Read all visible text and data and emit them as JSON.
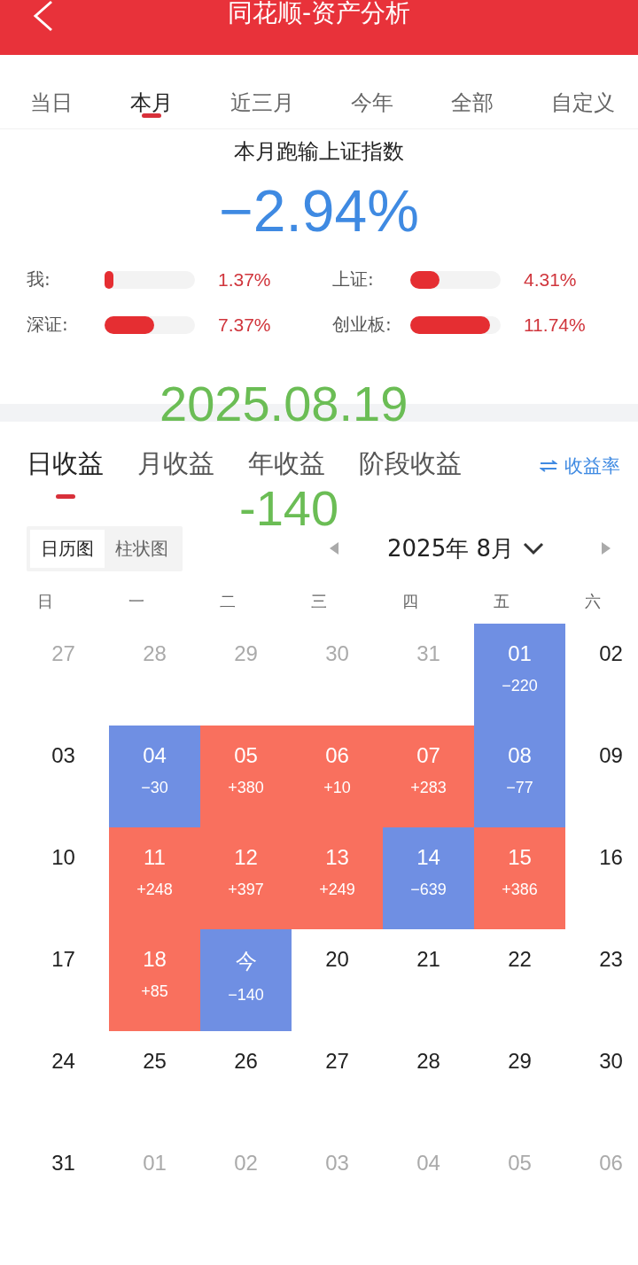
{
  "header": {
    "title": "同花顺-资产分析"
  },
  "period_tabs": [
    {
      "label": "当日",
      "selected": false
    },
    {
      "label": "本月",
      "selected": true
    },
    {
      "label": "近三月",
      "selected": false
    },
    {
      "label": "今年",
      "selected": false
    },
    {
      "label": "全部",
      "selected": false
    },
    {
      "label": "自定义",
      "selected": false
    }
  ],
  "summary": {
    "title": "本月跑输上证指数",
    "value": "−2.94%"
  },
  "comparisons": [
    {
      "label": "我:",
      "level": 0.1,
      "reading": "1.37%"
    },
    {
      "label": "上证:",
      "level": 0.32,
      "reading": "4.31%"
    },
    {
      "label": "深证:",
      "level": 0.55,
      "reading": "7.37%"
    },
    {
      "label": "创业板:",
      "level": 0.88,
      "reading": "11.74%"
    }
  ],
  "overlay": {
    "date": "2025.08.19",
    "amount": "-140"
  },
  "profit_tabs": [
    {
      "label": "日收益",
      "selected": true
    },
    {
      "label": "月收益",
      "selected": false
    },
    {
      "label": "年收益",
      "selected": false
    },
    {
      "label": "阶段收益",
      "selected": false
    }
  ],
  "rate_toggle": "收益率",
  "view_toggle": [
    {
      "label": "日历图",
      "selected": true
    },
    {
      "label": "柱状图",
      "selected": false
    }
  ],
  "month": "2025年 8月",
  "weekdays": [
    "日",
    "一",
    "二",
    "三",
    "四",
    "五",
    "六"
  ],
  "days": [
    {
      "day": "27",
      "kind": "other"
    },
    {
      "day": "28",
      "kind": "other"
    },
    {
      "day": "29",
      "kind": "other"
    },
    {
      "day": "30",
      "kind": "other"
    },
    {
      "day": "31",
      "kind": "other"
    },
    {
      "day": "01",
      "kind": "loss",
      "value": "−220"
    },
    {
      "day": "02",
      "kind": "plain"
    },
    {
      "day": "03",
      "kind": "plain"
    },
    {
      "day": "04",
      "kind": "loss",
      "value": "−30"
    },
    {
      "day": "05",
      "kind": "gain",
      "value": "+380"
    },
    {
      "day": "06",
      "kind": "gain",
      "value": "+10"
    },
    {
      "day": "07",
      "kind": "gain",
      "value": "+283"
    },
    {
      "day": "08",
      "kind": "loss",
      "value": "−77"
    },
    {
      "day": "09",
      "kind": "plain"
    },
    {
      "day": "10",
      "kind": "plain"
    },
    {
      "day": "11",
      "kind": "gain",
      "value": "+248"
    },
    {
      "day": "12",
      "kind": "gain",
      "value": "+397"
    },
    {
      "day": "13",
      "kind": "gain",
      "value": "+249"
    },
    {
      "day": "14",
      "kind": "loss",
      "value": "−639"
    },
    {
      "day": "15",
      "kind": "gain",
      "value": "+386"
    },
    {
      "day": "16",
      "kind": "plain"
    },
    {
      "day": "17",
      "kind": "plain"
    },
    {
      "day": "18",
      "kind": "gain",
      "value": "+85"
    },
    {
      "day": "今",
      "kind": "loss",
      "value": "−140"
    },
    {
      "day": "20",
      "kind": "plain"
    },
    {
      "day": "21",
      "kind": "plain"
    },
    {
      "day": "22",
      "kind": "plain"
    },
    {
      "day": "23",
      "kind": "plain"
    },
    {
      "day": "24",
      "kind": "plain"
    },
    {
      "day": "25",
      "kind": "plain"
    },
    {
      "day": "26",
      "kind": "plain"
    },
    {
      "day": "27",
      "kind": "plain"
    },
    {
      "day": "28",
      "kind": "plain"
    },
    {
      "day": "29",
      "kind": "plain"
    },
    {
      "day": "30",
      "kind": "plain"
    },
    {
      "day": "31",
      "kind": "plain"
    },
    {
      "day": "01",
      "kind": "other"
    },
    {
      "day": "02",
      "kind": "other"
    },
    {
      "day": "03",
      "kind": "other"
    },
    {
      "day": "04",
      "kind": "other"
    },
    {
      "day": "05",
      "kind": "other"
    },
    {
      "day": "06",
      "kind": "other"
    }
  ]
}
